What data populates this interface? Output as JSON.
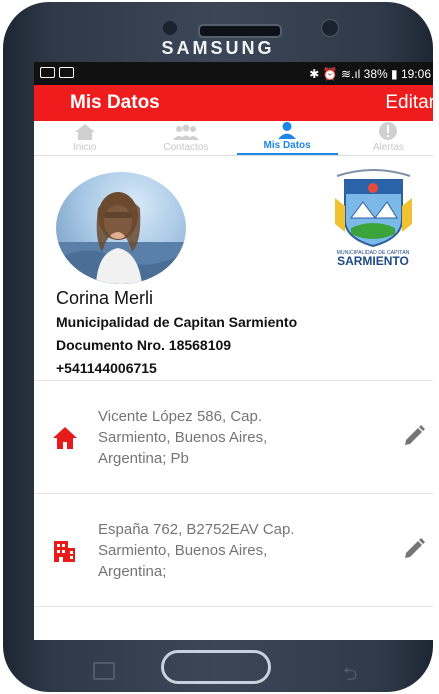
{
  "device": {
    "brand": "SAMSUNG"
  },
  "status_bar": {
    "right_text": "✱ ⏰ ≋.ıl 38% ▮ 19:06"
  },
  "app_bar": {
    "title": "Mis Datos",
    "action": "Editar"
  },
  "tabs": [
    {
      "label": "Inicio",
      "icon": "home-icon",
      "active": false
    },
    {
      "label": "Contactos",
      "icon": "contacts-icon",
      "active": false
    },
    {
      "label": "Mis Datos",
      "icon": "person-icon",
      "active": true
    },
    {
      "label": "Alertas",
      "icon": "alert-icon",
      "active": false
    }
  ],
  "profile": {
    "name": "Corina Merli",
    "organization": "Municipalidad de Capitan Sarmiento",
    "document": "Documento Nro. 18568109",
    "phone": "+541144006715",
    "logo_text_small": "MUNICIPALIDAD DE CAPITÁN",
    "logo_text_big": "SARMIENTO"
  },
  "addresses": [
    {
      "icon": "home-icon",
      "text": "Vicente López 586, Cap.\nSarmiento, Buenos Aires,\nArgentina; Pb"
    },
    {
      "icon": "building-icon",
      "text": "España 762, B2752EAV Cap.\nSarmiento, Buenos Aires,\nArgentina;"
    }
  ],
  "colors": {
    "primary": "#ee1c1c",
    "active_tab": "#1e86e6",
    "inactive_tab": "#c8c8c8"
  }
}
